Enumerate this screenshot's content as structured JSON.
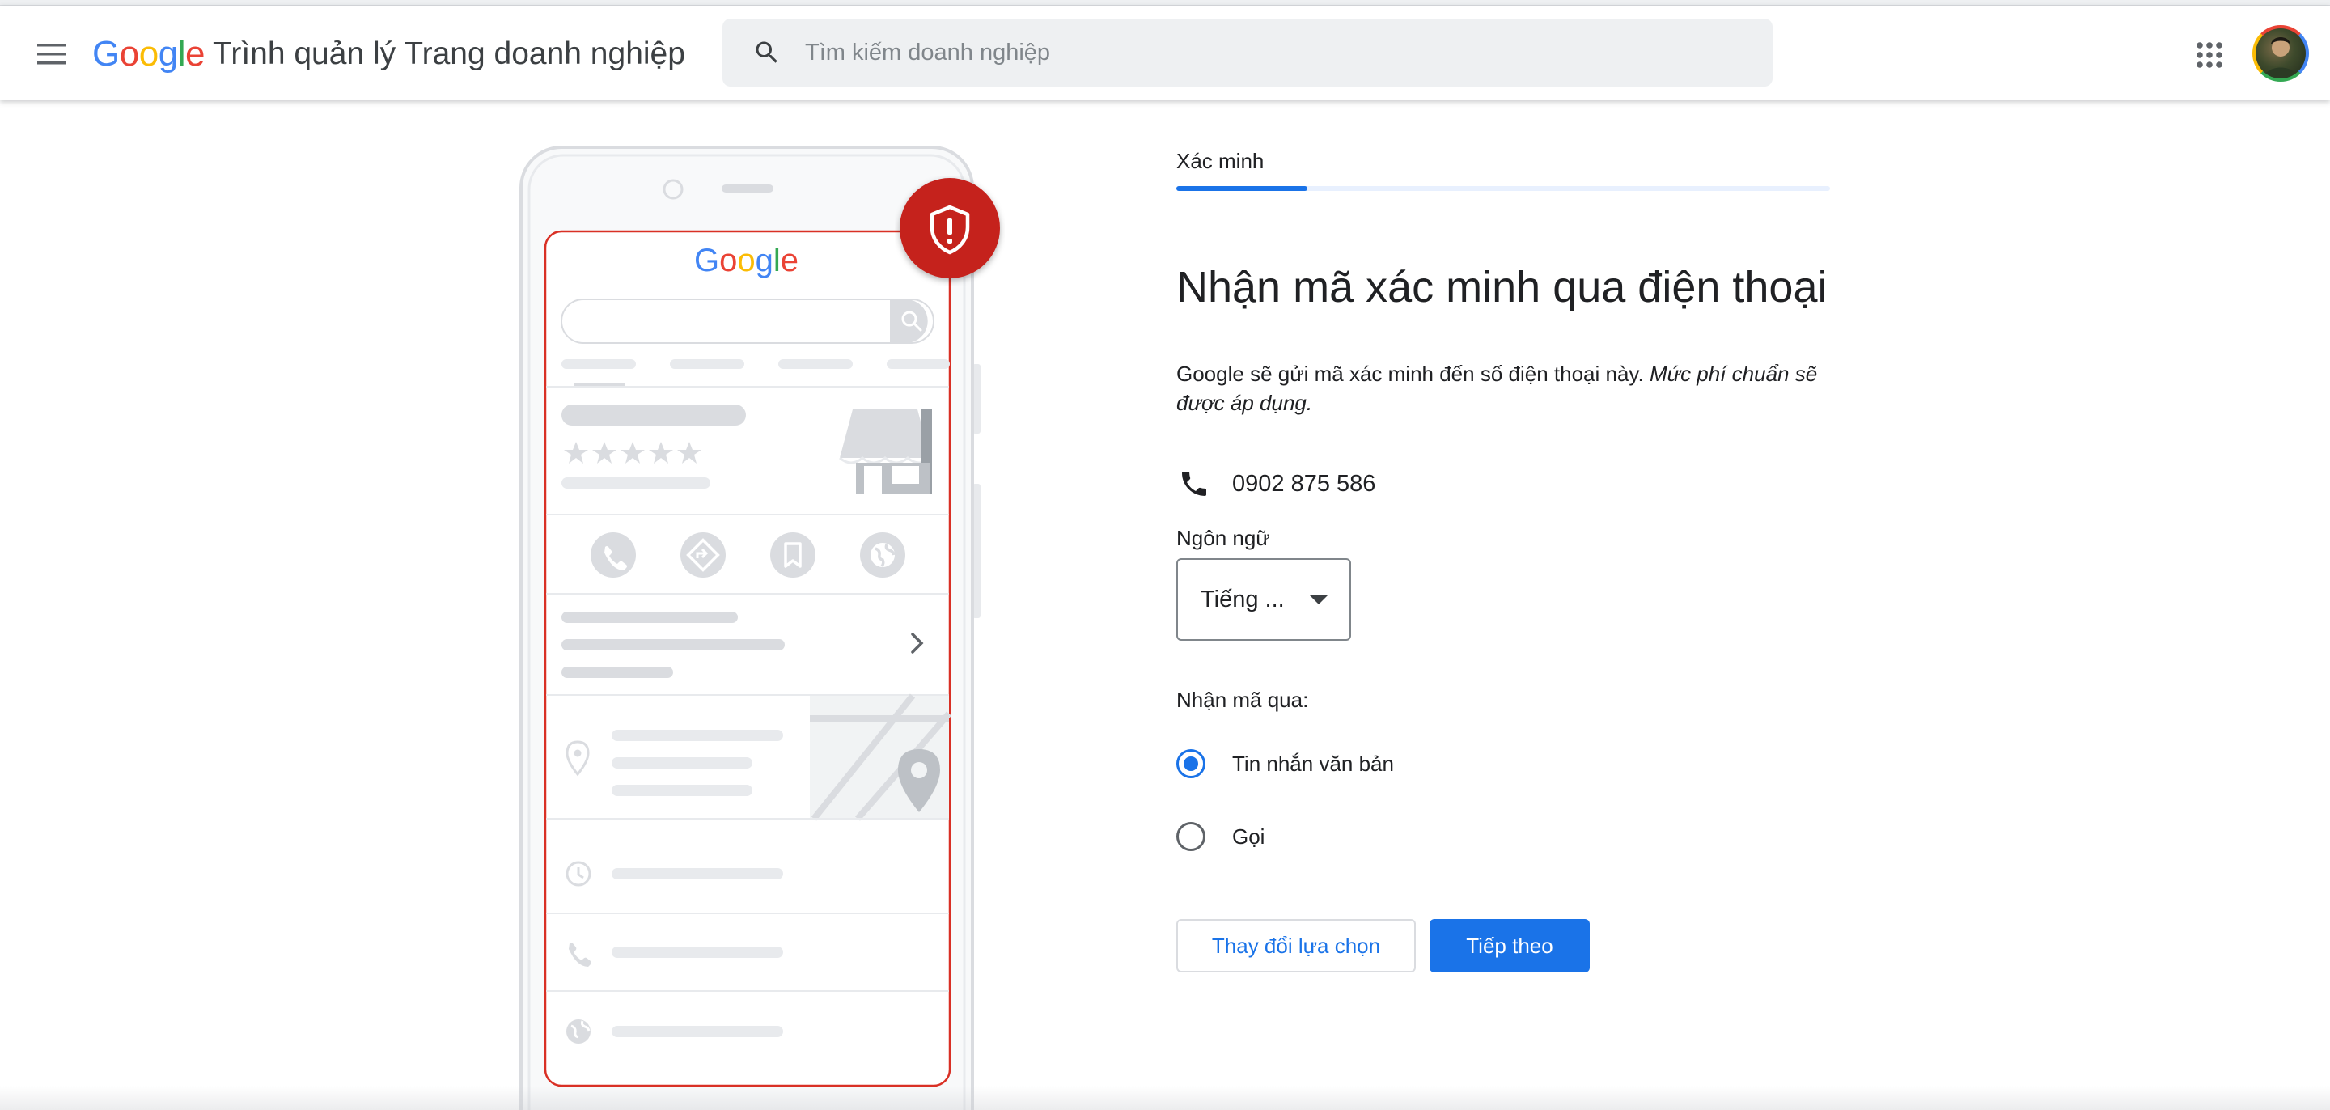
{
  "header": {
    "logo_letters": [
      "G",
      "o",
      "o",
      "g",
      "l",
      "e"
    ],
    "product_name": "Trình quản lý Trang doanh nghiệp",
    "search_placeholder": "Tìm kiếm doanh nghiệp",
    "icons": {
      "menu": "hamburger-menu-icon",
      "search": "search-icon",
      "apps": "apps-grid-icon",
      "avatar": "user-avatar"
    }
  },
  "illustration": {
    "logo_letters": [
      "G",
      "o",
      "o",
      "g",
      "l",
      "e"
    ],
    "alert_badge_icon": "shield-alert-icon",
    "action_icons": [
      "phone-icon",
      "directions-icon",
      "bookmark-icon",
      "globe-icon"
    ],
    "info_icons": [
      "location-pin-icon",
      "clock-icon",
      "phone-icon",
      "globe-icon"
    ],
    "rating_stars": 5
  },
  "verification": {
    "step_label": "Xác minh",
    "progress_fraction": 0.2,
    "title": "Nhận mã xác minh qua điện thoại",
    "description_plain": "Google sẽ gửi mã xác minh đến số điện thoại này. ",
    "description_italic": "Mức phí chuẩn sẽ được áp dụng.",
    "phone_icon": "phone-icon",
    "phone_number": "0902 875 586",
    "language_label": "Ngôn ngữ",
    "language_value": "Tiếng ...",
    "receive_via_label": "Nhận mã qua:",
    "options": [
      {
        "label": "Tin nhắn văn bản",
        "selected": true
      },
      {
        "label": "Gọi",
        "selected": false
      }
    ],
    "change_button": "Thay đổi lựa chọn",
    "next_button": "Tiếp theo"
  },
  "colors": {
    "accent": "#1a73e8",
    "alert_red": "#c5221f",
    "text": "#202124",
    "muted": "#dadce0"
  }
}
